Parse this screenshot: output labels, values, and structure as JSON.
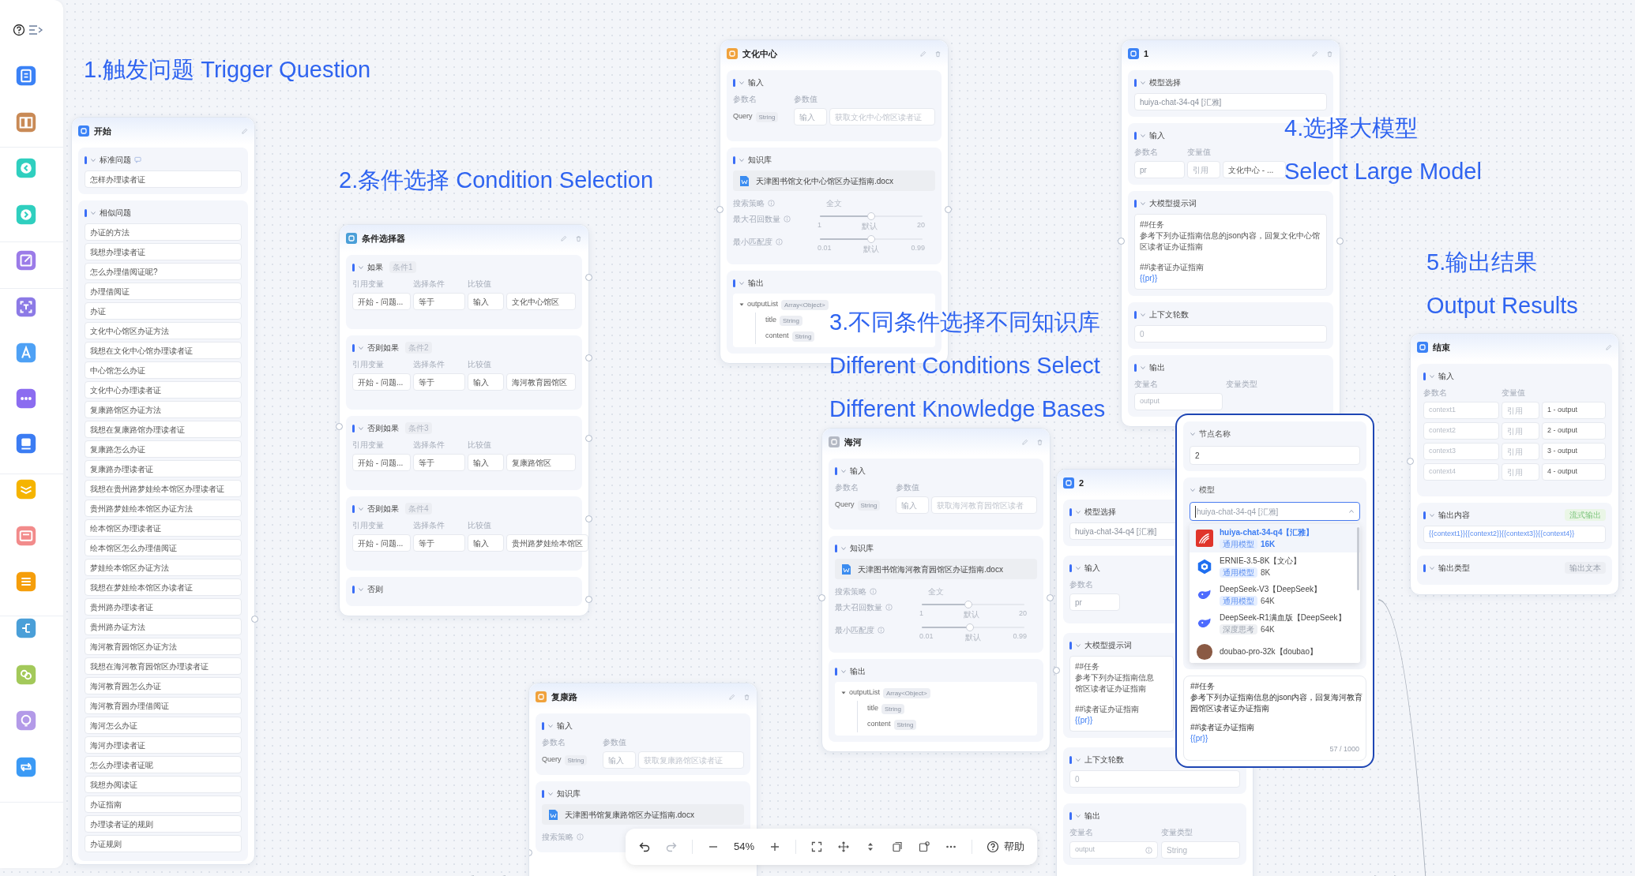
{
  "sidebar": {
    "items": [
      {
        "color": "#3b82f6"
      },
      {
        "color": "#c98a56"
      },
      {
        "color": "#2fcfbf"
      },
      {
        "color": "#2fcfbf"
      },
      {
        "color": "#9b7be8"
      },
      {
        "color": "#8c7ae6"
      },
      {
        "color": "#4ea1f5"
      },
      {
        "color": "#8b6cf0"
      },
      {
        "color": "#3b7cf3"
      },
      {
        "color": "#f5b400"
      },
      {
        "color": "#f28b8b"
      },
      {
        "color": "#f59e0b"
      },
      {
        "color": "#4a9fd8"
      },
      {
        "color": "#a3c95a"
      },
      {
        "color": "#b39ae8"
      },
      {
        "color": "#3b9af5"
      }
    ]
  },
  "annotations": [
    {
      "lines": [
        "1.触发问题 Trigger Question"
      ]
    },
    {
      "lines": [
        "2.条件选择 Condition Selection"
      ]
    },
    {
      "lines": [
        "3.不同条件选择不同知识库",
        "Different Conditions Select",
        "Different Knowledge Bases"
      ]
    },
    {
      "lines": [
        "4.选择大模型",
        "Select Large Model"
      ]
    },
    {
      "lines": [
        "5.输出结果",
        "Output Results"
      ]
    }
  ],
  "start_node": {
    "title": "开始",
    "color": "#3b82f6",
    "standard_question": {
      "label": "标准问题",
      "value": "怎样办理读者证"
    },
    "similar_questions": {
      "label": "相似问题",
      "items": [
        "办证的方法",
        "我想办理读者证",
        "怎么办理借阅证呢?",
        "办理借阅证",
        "办证",
        "文化中心馆区办证方法",
        "我想在文化中心馆办理读者证",
        "中心馆怎么办证",
        "文化中心办理读者证",
        "复康路馆区办证方法",
        "我想在复康路馆办理读者证",
        "复康路怎么办证",
        "复康路办理读者证",
        "我想在贵州路梦娃绘本馆区办理读者证",
        "贵州路梦娃绘本馆区办证方法",
        "绘本馆区办理读者证",
        "绘本馆区怎么办理借阅证",
        "梦娃绘本馆区办证方法",
        "我想在梦娃绘本馆区办读者证",
        "贵州路办理读者证",
        "贵州路办证方法",
        "海河教育园馆区办证方法",
        "我想在海河教育园馆区办理读者证",
        "海河教育园怎么办证",
        "海河教育园办理借阅证",
        "海河怎么办证",
        "海河办理读者证",
        "怎么办理读者证呢",
        "我想办阅读证",
        "办证指南",
        "办理读者证的规则",
        "办证规则"
      ]
    }
  },
  "condition_node": {
    "title": "条件选择器",
    "color": "#4a9fd8",
    "branches": [
      {
        "kind": "if",
        "label": "如果",
        "tag": "条件1",
        "column_labels": [
          "引用变量",
          "选择条件",
          "比较值"
        ],
        "variable": "开始 - 问题...",
        "operator": "等于",
        "source": "输入",
        "value": "文化中心馆区"
      },
      {
        "kind": "if",
        "label": "否则如果",
        "tag": "条件2",
        "column_labels": [
          "引用变量",
          "选择条件",
          "比较值"
        ],
        "variable": "开始 - 问题...",
        "operator": "等于",
        "source": "输入",
        "value": "海河教育园馆区"
      },
      {
        "kind": "if",
        "label": "否则如果",
        "tag": "条件3",
        "column_labels": [
          "引用变量",
          "选择条件",
          "比较值"
        ],
        "variable": "开始 - 问题...",
        "operator": "等于",
        "source": "输入",
        "value": "复康路馆区"
      },
      {
        "kind": "if",
        "label": "否则如果",
        "tag": "条件4",
        "column_labels": [
          "引用变量",
          "选择条件",
          "比较值"
        ],
        "variable": "开始 - 问题...",
        "operator": "等于",
        "source": "输入",
        "value": "贵州路梦娃绘本馆区"
      },
      {
        "kind": "else",
        "label": "否则"
      }
    ]
  },
  "knowledge_nodes": [
    {
      "title": "文化中心",
      "color": "#f0a23c",
      "input": {
        "label": "输入",
        "name_label": "参数名",
        "value_label": "参数值",
        "param": "Query",
        "type": "String",
        "source": "输入",
        "placeholder": "获取文化中心馆区读者证"
      },
      "knowledge": {
        "label": "知识库",
        "file": "天津图书馆文化中心馆区办证指南.docx",
        "strategy_label": "搜索策略",
        "strategy": "全文",
        "sliders": [
          {
            "label": "最大召回数量",
            "level": 0.5,
            "min": "1",
            "mid": "默认",
            "max": "20"
          },
          {
            "label": "最小匹配度",
            "level": 0.5,
            "min": "0.01",
            "mid": "默认",
            "max": "0.99"
          }
        ]
      },
      "output": {
        "label": "输出",
        "fields": [
          {
            "name": "outputList",
            "type": "Array<Object>",
            "children": [
              {
                "name": "title",
                "type": "String"
              },
              {
                "name": "content",
                "type": "String"
              }
            ]
          }
        ]
      }
    },
    {
      "title": "海河",
      "color": "#b4b9c4",
      "input": {
        "label": "输入",
        "name_label": "参数名",
        "value_label": "参数值",
        "param": "Query",
        "type": "String",
        "source": "输入",
        "placeholder": "获取海河教育园馆区读者"
      },
      "knowledge": {
        "label": "知识库",
        "file": "天津图书馆海河教育园馆区办证指南.docx",
        "strategy_label": "搜索策略",
        "strategy": "全文",
        "sliders": [
          {
            "label": "最大召回数量",
            "level": 0.45,
            "min": "1",
            "mid": "默认",
            "max": "20"
          },
          {
            "label": "最小匹配度",
            "level": 0.47,
            "min": "0.01",
            "mid": "默认",
            "max": "0.99"
          }
        ]
      },
      "output": {
        "label": "输出",
        "fields": [
          {
            "name": "outputList",
            "type": "Array<Object>",
            "children": [
              {
                "name": "title",
                "type": "String"
              },
              {
                "name": "content",
                "type": "String"
              }
            ]
          }
        ]
      }
    },
    {
      "title": "复康路",
      "color": "#f0a23c",
      "input": {
        "label": "输入",
        "name_label": "参数名",
        "value_label": "参数值",
        "param": "Query",
        "type": "String",
        "source": "输入",
        "placeholder": "获取复康路馆区读者证"
      },
      "knowledge": {
        "label": "知识库",
        "file": "天津图书馆复康路馆区办证指南.docx",
        "strategy_label": "搜索策略"
      }
    }
  ],
  "model_nodes": [
    {
      "title": "1",
      "color": "#3b82f6",
      "model": {
        "label": "模型选择",
        "value": "huiya-chat-34-q4 [汇雅]"
      },
      "input": {
        "label": "输入",
        "name_label": "参数名",
        "value_label": "变量值",
        "param": "pr",
        "source": "引用",
        "value": "文化中心 - ..."
      },
      "prompt": {
        "label": "大模型提示词",
        "heading": "##任务",
        "task_lines": [
          "参考下列办证指南信息的json内容，回复文化中心馆",
          "区读者证办证指南"
        ],
        "guide_heading": "##读者证办证指南",
        "variable": "{{pr}}"
      },
      "context": {
        "label": "上下文轮数",
        "value": "0"
      },
      "output": {
        "label": "输出",
        "name_label": "变量名",
        "type_label": "变量类型",
        "name": "output"
      }
    },
    {
      "title": "2",
      "color": "#3b82f6",
      "model": {
        "label": "模型选择",
        "value": "huiya-chat-34-q4 [汇雅]"
      },
      "input": {
        "label": "输入",
        "name_label": "参数名",
        "param": "pr"
      },
      "prompt": {
        "label": "大模型提示词",
        "heading": "##任务",
        "task_lines": [
          "参考下列办证指南信息",
          "馆区读者证办证指南"
        ],
        "guide_heading": "##读者证办证指南",
        "variable": "{{pr}}"
      },
      "context": {
        "label": "上下文轮数",
        "value": "0"
      },
      "output": {
        "label": "输出",
        "name_label": "变量名",
        "type_label": "变量类型",
        "name": "output",
        "type": "String"
      }
    }
  ],
  "end_node": {
    "title": "结束",
    "color": "#3b82f6",
    "input": {
      "label": "输入",
      "name_label": "参数名",
      "value_label": "变量值",
      "rows": [
        {
          "name": "context1",
          "source": "引用",
          "value": "1 - output"
        },
        {
          "name": "context2",
          "source": "引用",
          "value": "2 - output"
        },
        {
          "name": "context3",
          "source": "引用",
          "value": "3 - output"
        },
        {
          "name": "context4",
          "source": "引用",
          "value": "4 - output"
        }
      ]
    },
    "content": {
      "label": "输出内容",
      "badge": "流式输出",
      "template": "{{context1}}{{context2}}{{context3}}{{context4}}"
    },
    "output_type": {
      "label": "输出类型",
      "value": "输出文本"
    }
  },
  "settings_panel": {
    "name_section": {
      "label": "节点名称",
      "value": "2"
    },
    "model_section": {
      "label": "模型",
      "value": "huiya-chat-34-q4 [汇雅]",
      "options": [
        {
          "kind": "huiya",
          "name": "huiya-chat-34-q4【汇雅】",
          "tag": "通用模型",
          "context": "16K",
          "selected": true
        },
        {
          "kind": "ernie",
          "name": "ERNIE-3.5-8K【文心】",
          "tag": "通用模型",
          "context": "8K",
          "selected": false
        },
        {
          "kind": "deepseek",
          "name": "DeepSeek-V3【DeepSeek】",
          "tag": "通用模型",
          "context": "64K",
          "selected": false
        },
        {
          "kind": "deepseek",
          "name": "DeepSeek-R1满血版【DeepSeek】",
          "tag": "深度思考",
          "context": "64K",
          "selected": false
        },
        {
          "kind": "doubao",
          "name": "doubao-pro-32k【doubao】",
          "selected": false
        }
      ]
    },
    "prompt": {
      "heading": "##任务",
      "task_lines": [
        "参考下列办证指南信息的json内容，回复海河教育",
        "园馆区读者证办证指南"
      ],
      "guide_heading": "##读者证办证指南",
      "variable": "{{pr}}",
      "counter": "57 / 1000"
    }
  },
  "toolbar": {
    "zoom": "54%",
    "help": "帮助"
  }
}
